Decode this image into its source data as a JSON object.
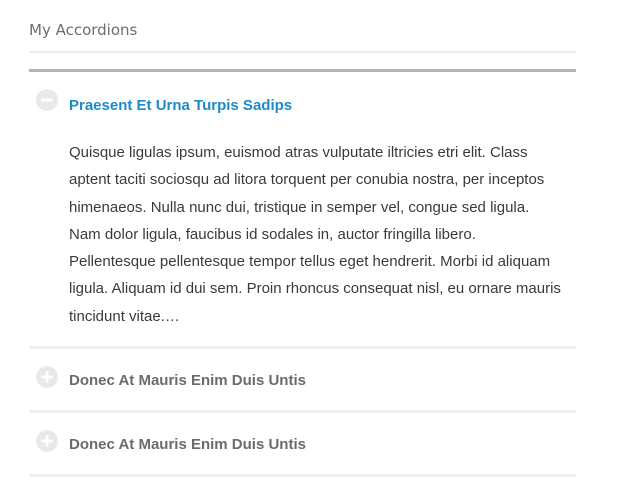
{
  "widget": {
    "title": "My Accordions"
  },
  "accordion": {
    "items": [
      {
        "title": "Praesent Et Urna Turpis Sadips",
        "state": "open",
        "toggle_icon": "minus-icon",
        "content": "Quisque ligulas ipsum, euismod atras vulputate iltricies etri elit. Class aptent taciti sociosqu ad litora torquent per conubia nostra, per inceptos himenaeos. Nulla nunc dui, tristique in semper vel, congue sed ligula. Nam dolor ligula, faucibus id sodales in, auctor fringilla libero. Pellentesque pellentesque tempor tellus eget hendrerit. Morbi id aliquam ligula. Aliquam id dui sem. Proin rhoncus consequat nisl, eu ornare mauris tincidunt vitae.…"
      },
      {
        "title": "Donec At Mauris Enim Duis Untis",
        "state": "closed",
        "toggle_icon": "plus-icon"
      },
      {
        "title": "Donec At Mauris Enim Duis Untis",
        "state": "closed",
        "toggle_icon": "plus-icon"
      }
    ]
  },
  "colors": {
    "active_title": "#1b8bc9",
    "inactive_title": "#6b6b6b",
    "toggle_bg": "#e9e9e9",
    "toggle_symbol": "#ffffff"
  }
}
